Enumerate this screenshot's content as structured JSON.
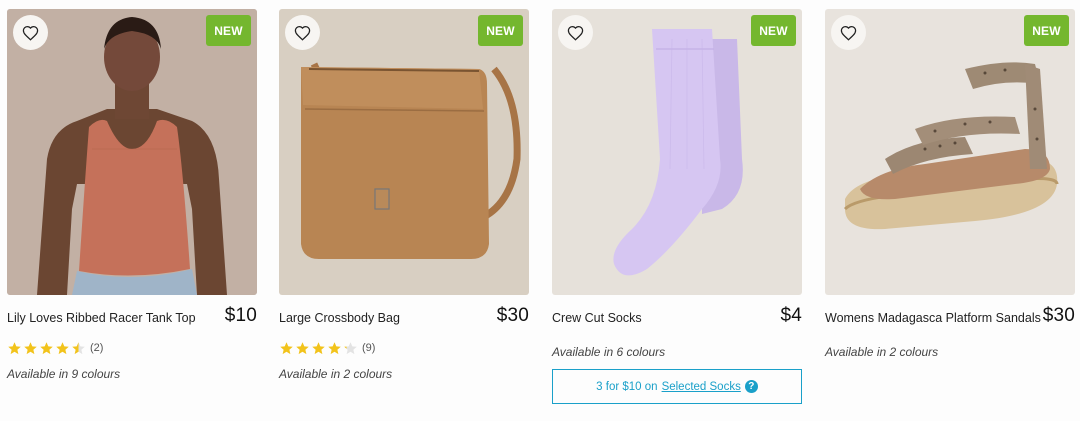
{
  "products": [
    {
      "badge": "NEW",
      "name": "Lily Loves Ribbed Racer Tank Top",
      "price": "$10",
      "rating": 4.5,
      "review_count": "(2)",
      "availability": "Available in 9 colours",
      "image": "orange-ribbed-tank-top-on-model"
    },
    {
      "badge": "NEW",
      "name": "Large Crossbody Bag",
      "price": "$30",
      "rating": 4,
      "review_count": "(9)",
      "availability": "Available in 2 colours",
      "image": "tan-crossbody-bag"
    },
    {
      "badge": "NEW",
      "name": "Crew Cut Socks",
      "price": "$4",
      "availability": "Available in 6 colours",
      "image": "lilac-crew-socks",
      "promo": {
        "prefix": "3 for $10 on",
        "link": "Selected Socks",
        "help": "?"
      }
    },
    {
      "badge": "NEW",
      "name": "Womens Madagasca Platform Sandals",
      "price": "$30",
      "availability": "Available in 2 colours",
      "image": "leopard-platform-sandals"
    }
  ],
  "icons": {
    "favourite": "heart-outline-icon",
    "rating": "star-icon",
    "help": "question-circle-icon"
  },
  "colors": {
    "badge": "#74b72e",
    "star": "#f2c31b",
    "promo": "#1aa0c9"
  }
}
